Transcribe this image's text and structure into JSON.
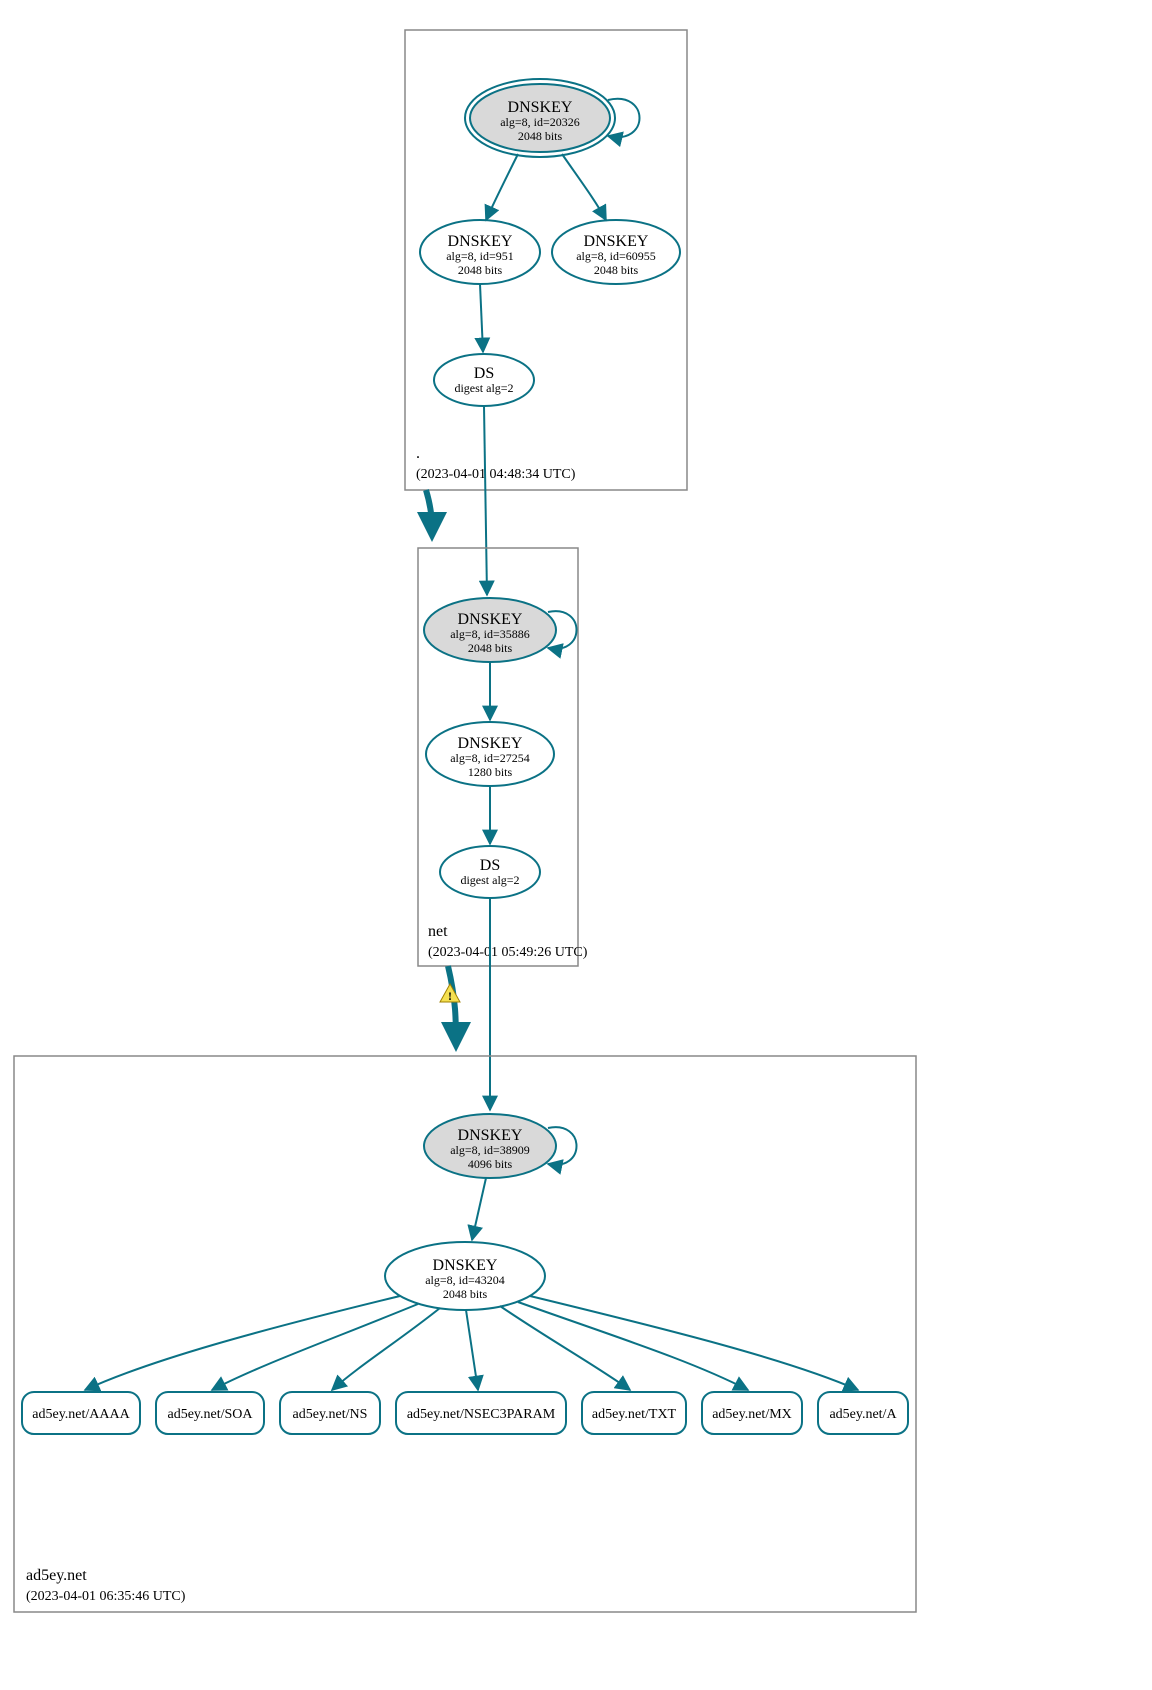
{
  "colors": {
    "stroke": "#0b7285",
    "ksk_fill": "#d9d9d9",
    "zone_border": "#888888",
    "warn_fill": "#f5e050",
    "warn_stroke": "#a08000"
  },
  "zones": {
    "root": {
      "name": ".",
      "timestamp": "(2023-04-01 04:48:34 UTC)"
    },
    "net": {
      "name": "net",
      "timestamp": "(2023-04-01 05:49:26 UTC)"
    },
    "domain": {
      "name": "ad5ey.net",
      "timestamp": "(2023-04-01 06:35:46 UTC)"
    }
  },
  "nodes": {
    "root_ksk": {
      "title": "DNSKEY",
      "line1": "alg=8, id=20326",
      "line2": "2048 bits"
    },
    "root_zsk1": {
      "title": "DNSKEY",
      "line1": "alg=8, id=951",
      "line2": "2048 bits"
    },
    "root_zsk2": {
      "title": "DNSKEY",
      "line1": "alg=8, id=60955",
      "line2": "2048 bits"
    },
    "root_ds": {
      "title": "DS",
      "line1": "digest alg=2"
    },
    "net_ksk": {
      "title": "DNSKEY",
      "line1": "alg=8, id=35886",
      "line2": "2048 bits"
    },
    "net_zsk": {
      "title": "DNSKEY",
      "line1": "alg=8, id=27254",
      "line2": "1280 bits"
    },
    "net_ds": {
      "title": "DS",
      "line1": "digest alg=2"
    },
    "dom_ksk": {
      "title": "DNSKEY",
      "line1": "alg=8, id=38909",
      "line2": "4096 bits"
    },
    "dom_zsk": {
      "title": "DNSKEY",
      "line1": "alg=8, id=43204",
      "line2": "2048 bits"
    }
  },
  "rrsets": {
    "aaaa": "ad5ey.net/AAAA",
    "soa": "ad5ey.net/SOA",
    "ns": "ad5ey.net/NS",
    "n3p": "ad5ey.net/NSEC3PARAM",
    "txt": "ad5ey.net/TXT",
    "mx": "ad5ey.net/MX",
    "a": "ad5ey.net/A"
  },
  "warn_glyph": "!"
}
